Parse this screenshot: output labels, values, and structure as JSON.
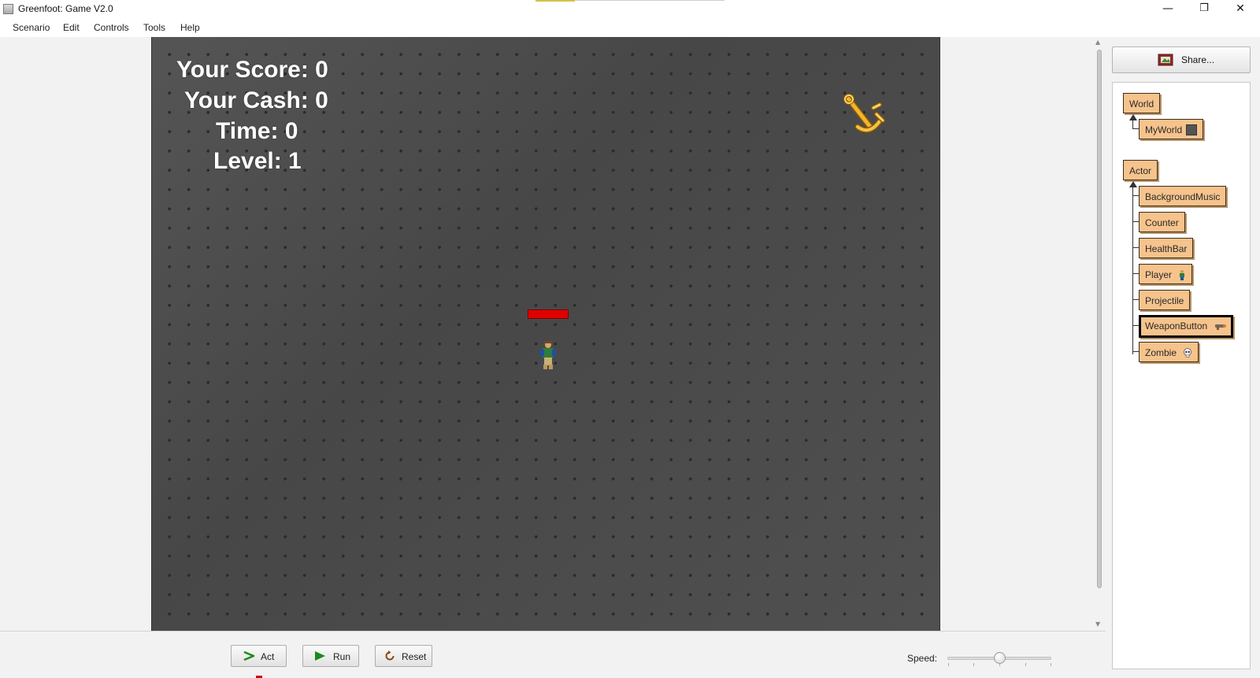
{
  "window": {
    "title": "Greenfoot: Game V2.0",
    "minimize": "—",
    "restore": "❐",
    "close": "✕"
  },
  "menu": [
    "Scenario",
    "Edit",
    "Controls",
    "Tools",
    "Help"
  ],
  "hud": {
    "score": "Your Score: 0",
    "cash": "Your Cash: 0",
    "time": "Time: 0",
    "level": "Level: 1"
  },
  "player_health": 1.0,
  "sidebar": {
    "share_label": "Share..."
  },
  "classes": {
    "world_root": "World",
    "world_subclasses": [
      "MyWorld"
    ],
    "actor_root": "Actor",
    "actor_subclasses": [
      "BackgroundMusic",
      "Counter",
      "HealthBar",
      "Player",
      "Projectile",
      "WeaponButton",
      "Zombie"
    ],
    "selected": "WeaponButton"
  },
  "controls": {
    "act": "Act",
    "run": "Run",
    "reset": "Reset",
    "speed_label": "Speed:",
    "speed_value": 0.5
  },
  "colors": {
    "class_box": "#f6c38c",
    "healthbar": "#e00000",
    "hud_text": "#ffffff",
    "run_icon": "#1a8a1a",
    "anchor": "#e3a21a"
  }
}
